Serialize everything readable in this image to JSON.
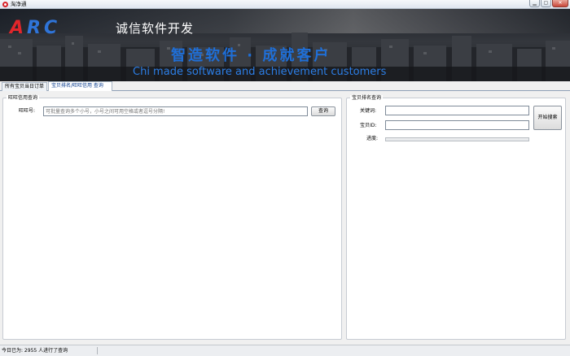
{
  "window": {
    "title": "淘净通",
    "minimize_glyph": "▁",
    "maximize_glyph": "▢",
    "close_glyph": "✕"
  },
  "banner": {
    "logo_a": "A",
    "logo_rc": "RC",
    "logo_subtitle": "诚信软件开发",
    "slogan_cn": "智造软件 · 成就客户",
    "slogan_en": "Chi made software and achievement customers"
  },
  "tabs": [
    {
      "label": "所有宝贝当日订单"
    },
    {
      "label": "宝贝排名/旺旺信用 查询"
    }
  ],
  "wangwang_panel": {
    "title": "旺旺信用查询",
    "field_label": "旺旺号:",
    "input_placeholder": "可批量查询多个小号，小号之间可用空格或者逗号分隔!",
    "query_button": "查询"
  },
  "ranking_panel": {
    "title": "宝贝排名查询",
    "keyword_label": "关键词:",
    "item_id_label": "宝贝ID:",
    "progress_label": "进度:",
    "progress": 0,
    "search_button": "开始搜索"
  },
  "status": {
    "text": "今日已为: 2955 人进行了查询"
  },
  "colors": {
    "logo_red": "#e0262b",
    "logo_blue": "#2f74d8",
    "slogan_blue": "#1f6fd8"
  }
}
